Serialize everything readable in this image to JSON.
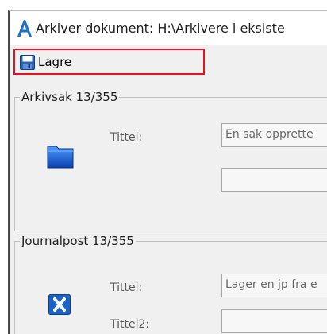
{
  "window": {
    "title": "Arkiver dokument: H:\\Arkivere i eksiste"
  },
  "toolbar": {
    "save_label": "Lagre"
  },
  "archive_case": {
    "legend": "Arkivsak 13/355",
    "title_label": "Tittel:",
    "title_value": "En sak opprette",
    "second_value": ""
  },
  "journal_post": {
    "legend": "Journalpost 13/355",
    "title_label": "Tittel:",
    "title_value": "Lager en jp fra e",
    "title2_label": "Tittel2:",
    "title2_value": ""
  },
  "colors": {
    "highlight_border": "#e8101f",
    "app_icon": "#1f6fc4",
    "folder_icon": "#1565d8"
  }
}
